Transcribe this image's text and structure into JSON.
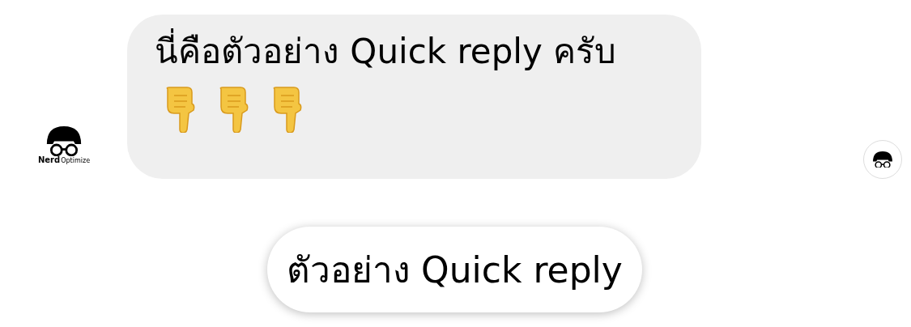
{
  "message": {
    "text": "นี่คือตัวอย่าง Quick reply ครับ",
    "emojis": [
      {
        "kind": "pointing-down"
      },
      {
        "kind": "pointing-down"
      },
      {
        "kind": "pointing-down"
      }
    ]
  },
  "sender_avatar": {
    "brand": "Nerd",
    "tagline": "Optimize"
  },
  "quick_replies": [
    {
      "label": "ตัวอย่าง Quick reply"
    }
  ]
}
